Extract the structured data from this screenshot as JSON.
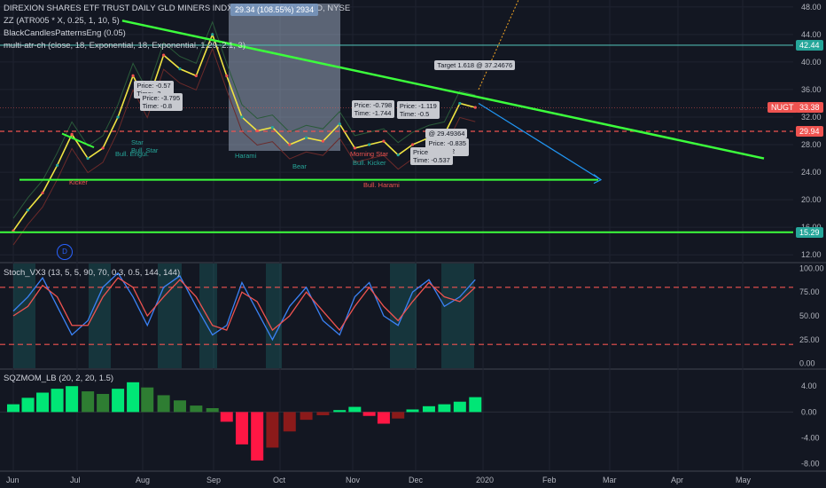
{
  "header": {
    "title": "DIREXION SHARES ETF TRUST DAILY GLD MINERS INDX BULL 3X SHS(P/S), 1D, NYSE",
    "selection_info": "29.34 (108.55%) 2934",
    "studies": [
      "ZZ (ATR005 * X, 0.25, 1, 10, 5)",
      "BlackCandlesPatternsEng (0.05)",
      "multi-atr-ch (close, 18, Exponential, 18, Exponential, 1.29, 2.1, 3)"
    ]
  },
  "price_tags": [
    {
      "label": "42.44",
      "value": 42.44,
      "color": "#26a69a"
    },
    {
      "label": "NUGT",
      "value": 33.38,
      "color": "#ef5350"
    },
    {
      "label": "33.38",
      "value": 33.38,
      "color": "#ef5350"
    },
    {
      "label": "29.94",
      "value": 29.94,
      "color": "#ef5350"
    },
    {
      "label": "15.29",
      "value": 15.29,
      "color": "#26a69a"
    }
  ],
  "annotations": [
    {
      "text": "Price: -0.57\nTime: -2",
      "price": 36.2,
      "x_date": "Jul 30"
    },
    {
      "text": "Price: -3.795\nTime: -0.8",
      "price": 34.4,
      "x_date": "Aug 2"
    },
    {
      "text": "Price: -0.798\nTime: -1.744",
      "price": 33.4,
      "x_date": "Nov 3"
    },
    {
      "text": "Price: -1.119\nTime: -0.5",
      "price": 33.3,
      "x_date": "Nov 25"
    },
    {
      "text": "Target 1.618 @ 37.24676",
      "price": 39.2,
      "x_date": "Dec 12"
    },
    {
      "text": "@ 29.49364",
      "price": 29.3,
      "x_date": "Dec 8"
    },
    {
      "text": "Price: -0.835\nTimer: -2",
      "price": 27.9,
      "x_date": "Dec 8"
    },
    {
      "text": "Price\nTime: -0.537",
      "price": 26.6,
      "x_date": "Dec 1"
    }
  ],
  "pattern_labels": [
    "Harami",
    "Bull. Engul.",
    "Kicker",
    "Star",
    "Bull. Star",
    "Morning Star",
    "Bull. Kicker",
    "Bear",
    "Bull. Harami"
  ],
  "stoch_label": "Stoch_VX3 (13, 5, 5, 90, 70, 0.3, 0.5, 144, 144)",
  "sqzmom_label": "SQZMOM_LB (20, 2, 20, 1.5)",
  "d_marker": "D",
  "chart_data": [
    {
      "type": "line",
      "title": "DIREXION SHARES ETF TRUST DAILY GLD MINERS INDX BULL 3X SHS(P/S), 1D, NYSE",
      "x": [
        "Jun 1",
        "Jun 8",
        "Jun 15",
        "Jun 22",
        "Jun 29",
        "Jul 6",
        "Jul 13",
        "Jul 20",
        "Jul 27",
        "Aug 3",
        "Aug 10",
        "Aug 17",
        "Aug 24",
        "Aug 31",
        "Sep 7",
        "Sep 14",
        "Sep 21",
        "Sep 28",
        "Oct 5",
        "Oct 12",
        "Oct 19",
        "Oct 26",
        "Nov 2",
        "Nov 9",
        "Nov 16",
        "Nov 23",
        "Nov 30",
        "Dec 7",
        "Dec 14",
        "Dec 21",
        "Dec 28"
      ],
      "series": [
        {
          "values": [
            15.5,
            18.5,
            21,
            25,
            29.5,
            26,
            27.5,
            32,
            38,
            34,
            41,
            39,
            38,
            44,
            38,
            32,
            30,
            30.5,
            28,
            29,
            28.5,
            31,
            27.5,
            28,
            28.5,
            26.5,
            28,
            29,
            29.5,
            34,
            33.4
          ]
        }
      ],
      "x_ticks": [
        "Jun",
        "Jul",
        "Aug",
        "Sep",
        "Oct",
        "Nov",
        "Dec",
        "2020",
        "Feb",
        "Mar",
        "Apr",
        "May"
      ],
      "y_ticks": [
        12.0,
        16.0,
        20.0,
        24.0,
        28.0,
        32.0,
        36.0,
        40.0,
        44.0,
        48.0
      ],
      "ylim": [
        11,
        49
      ],
      "last_price": 33.38,
      "levels": [
        42.44,
        29.94,
        22.9,
        15.29
      ],
      "trendline_falling": [
        [
          "Jul 22",
          46
        ],
        [
          "Mar 1",
          26
        ]
      ]
    },
    {
      "type": "line",
      "title": "Stoch_VX3 (13, 5, 5, 90, 70, 0.3, 0.5, 144, 144)",
      "series": [
        {
          "name": "k",
          "values": [
            55,
            70,
            90,
            60,
            30,
            45,
            80,
            95,
            70,
            40,
            80,
            92,
            60,
            30,
            40,
            85,
            55,
            25,
            60,
            80,
            45,
            30,
            70,
            85,
            50,
            40,
            75,
            88,
            60,
            70,
            88
          ]
        },
        {
          "name": "d",
          "values": [
            50,
            60,
            82,
            70,
            40,
            40,
            70,
            90,
            80,
            50,
            70,
            88,
            70,
            40,
            35,
            75,
            65,
            35,
            50,
            75,
            55,
            35,
            60,
            80,
            60,
            45,
            65,
            85,
            70,
            65,
            80
          ]
        }
      ],
      "y_ticks": [
        0.0,
        25.0,
        50.0,
        75.0,
        100.0
      ],
      "ylim": [
        -5,
        105
      ],
      "levels": [
        80,
        20
      ]
    },
    {
      "type": "bar",
      "title": "SQZMOM_LB (20, 2, 20, 1.5)",
      "values": [
        1.2,
        2.2,
        3.0,
        3.6,
        4.0,
        3.2,
        2.8,
        3.6,
        4.6,
        3.8,
        2.6,
        1.8,
        1.0,
        0.6,
        -1.5,
        -5,
        -7.5,
        -5.5,
        -3,
        -1.2,
        -0.5,
        0.3,
        0.8,
        -0.6,
        -1.8,
        -1.0,
        0.4,
        0.9,
        1.2,
        1.6,
        2.3
      ],
      "y_ticks": [
        -8.0,
        -4.0,
        0.0,
        4.0
      ],
      "ylim": [
        -9,
        6.5
      ]
    }
  ]
}
